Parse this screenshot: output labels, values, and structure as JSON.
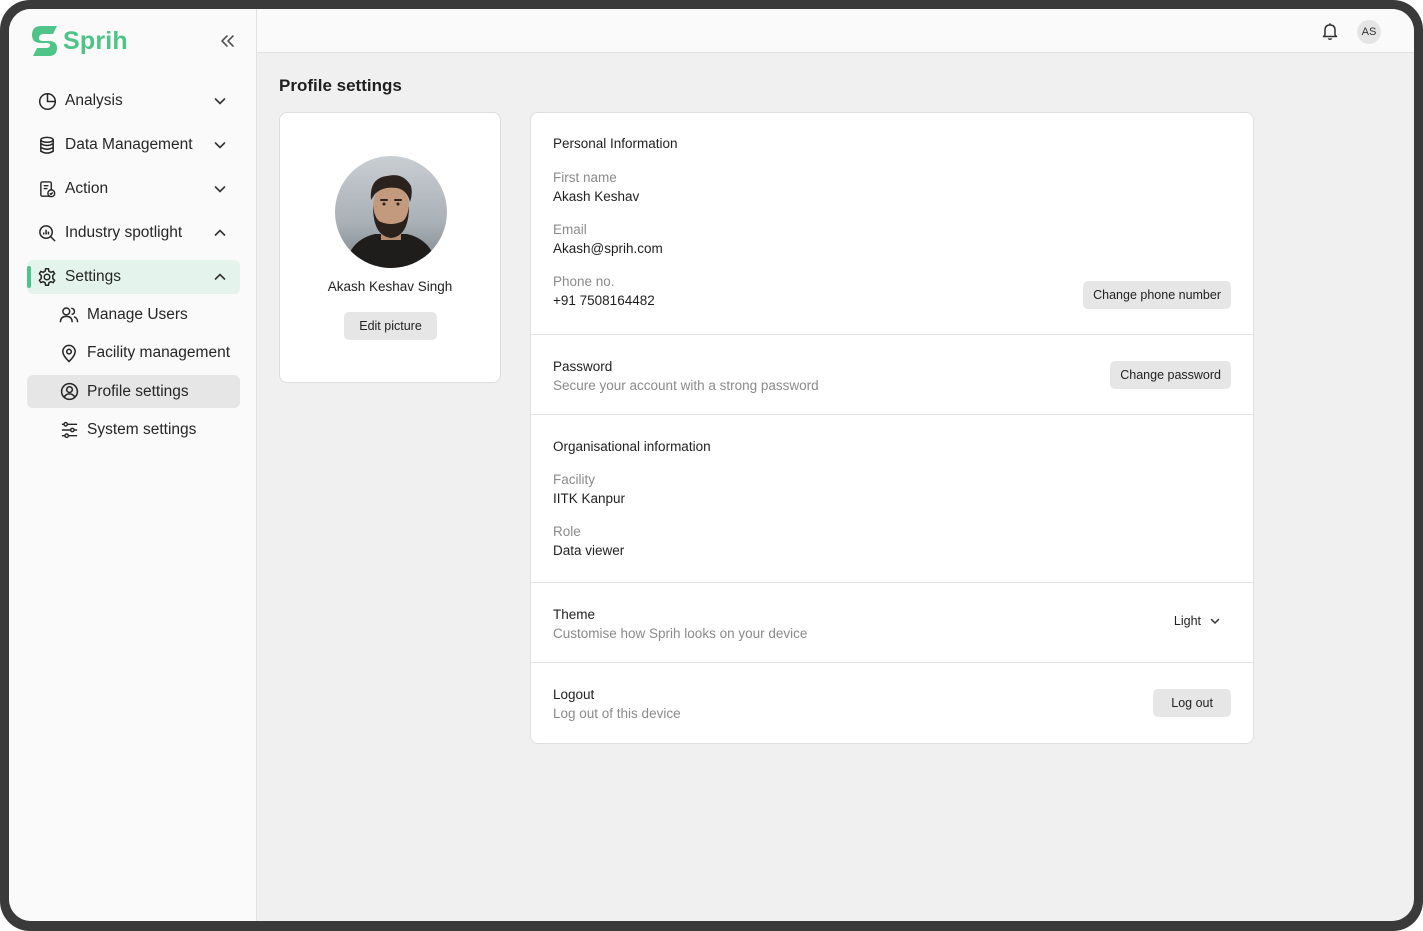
{
  "brand": {
    "name": "Sprih",
    "accent": "#4fc488"
  },
  "sidebar": {
    "items": [
      {
        "label": "Analysis",
        "icon": "pie-chart-icon",
        "chevron": "down"
      },
      {
        "label": "Data Management",
        "icon": "database-icon",
        "chevron": "down"
      },
      {
        "label": "Action",
        "icon": "clipboard-check-icon",
        "chevron": "down"
      },
      {
        "label": "Industry spotlight",
        "icon": "magnify-chart-icon",
        "chevron": "up"
      },
      {
        "label": "Settings",
        "icon": "gear-icon",
        "chevron": "up",
        "active": true
      }
    ],
    "settings_sub": [
      {
        "label": "Manage Users",
        "icon": "users-icon"
      },
      {
        "label": "Facility management",
        "icon": "location-pin-icon"
      },
      {
        "label": "Profile settings",
        "icon": "user-circle-icon",
        "selected": true
      },
      {
        "label": "System settings",
        "icon": "sliders-icon"
      }
    ]
  },
  "topbar": {
    "avatar_initials": "AS"
  },
  "page": {
    "title": "Profile settings"
  },
  "profile": {
    "name": "Akash Keshav Singh",
    "edit_label": "Edit picture"
  },
  "personal": {
    "title": "Personal Information",
    "first_name_label": "First name",
    "first_name": "Akash Keshav",
    "email_label": "Email",
    "email": "Akash@sprih.com",
    "phone_label": "Phone no.",
    "phone": "+91 7508164482",
    "change_phone_label": "Change phone number"
  },
  "password": {
    "title": "Password",
    "desc": "Secure your account with a strong password",
    "button": "Change password"
  },
  "organisation": {
    "title": "Organisational information",
    "facility_label": "Facility",
    "facility": "IITK Kanpur",
    "role_label": "Role",
    "role": "Data viewer"
  },
  "theme": {
    "title": "Theme",
    "desc": "Customise how Sprih looks on your device",
    "value": "Light"
  },
  "logout": {
    "title": "Logout",
    "desc": "Log out of this device",
    "button": "Log out"
  }
}
